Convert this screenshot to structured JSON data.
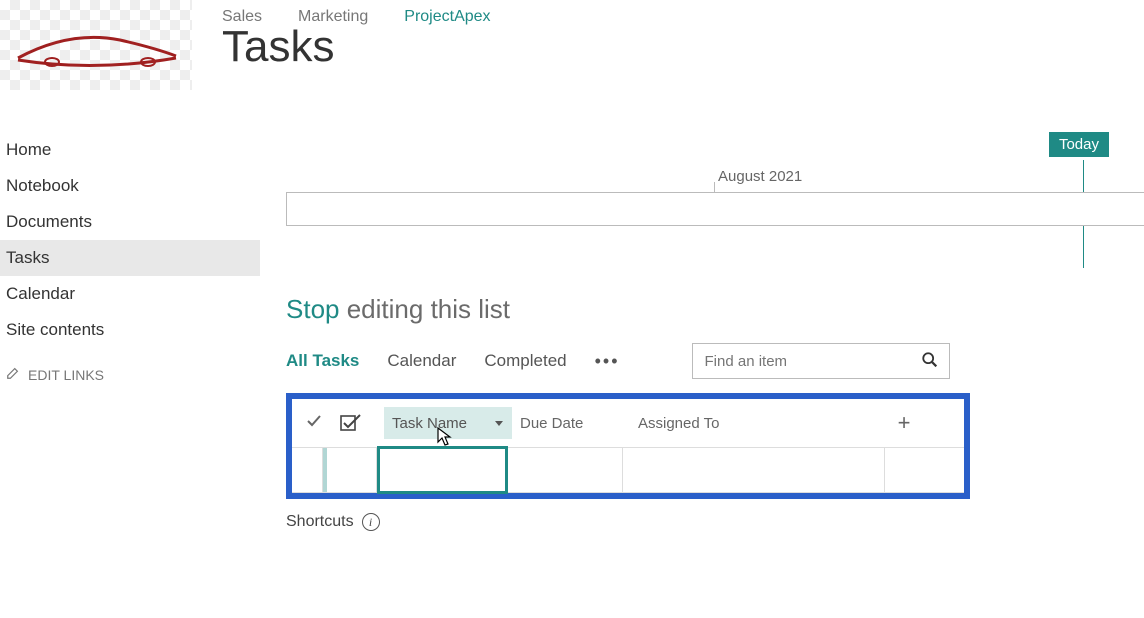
{
  "header": {
    "nav": [
      {
        "label": "Sales",
        "active": false
      },
      {
        "label": "Marketing",
        "active": false
      },
      {
        "label": "ProjectApex",
        "active": true
      }
    ],
    "page_title": "Tasks"
  },
  "sidebar": {
    "items": [
      {
        "label": "Home",
        "active": false
      },
      {
        "label": "Notebook",
        "active": false
      },
      {
        "label": "Documents",
        "active": false
      },
      {
        "label": "Tasks",
        "active": true
      },
      {
        "label": "Calendar",
        "active": false
      },
      {
        "label": "Site contents",
        "active": false
      }
    ],
    "edit_links_label": "EDIT LINKS"
  },
  "timeline": {
    "today_label": "Today",
    "month_label": "August 2021"
  },
  "editing": {
    "stop_label": "Stop",
    "rest_label": " editing this list"
  },
  "views": {
    "tabs": [
      {
        "label": "All Tasks",
        "active": true
      },
      {
        "label": "Calendar",
        "active": false
      },
      {
        "label": "Completed",
        "active": false
      }
    ]
  },
  "search": {
    "placeholder": "Find an item"
  },
  "table": {
    "columns": {
      "task_name": "Task Name",
      "due_date": "Due Date",
      "assigned_to": "Assigned To"
    }
  },
  "footer": {
    "shortcuts_label": "Shortcuts"
  }
}
